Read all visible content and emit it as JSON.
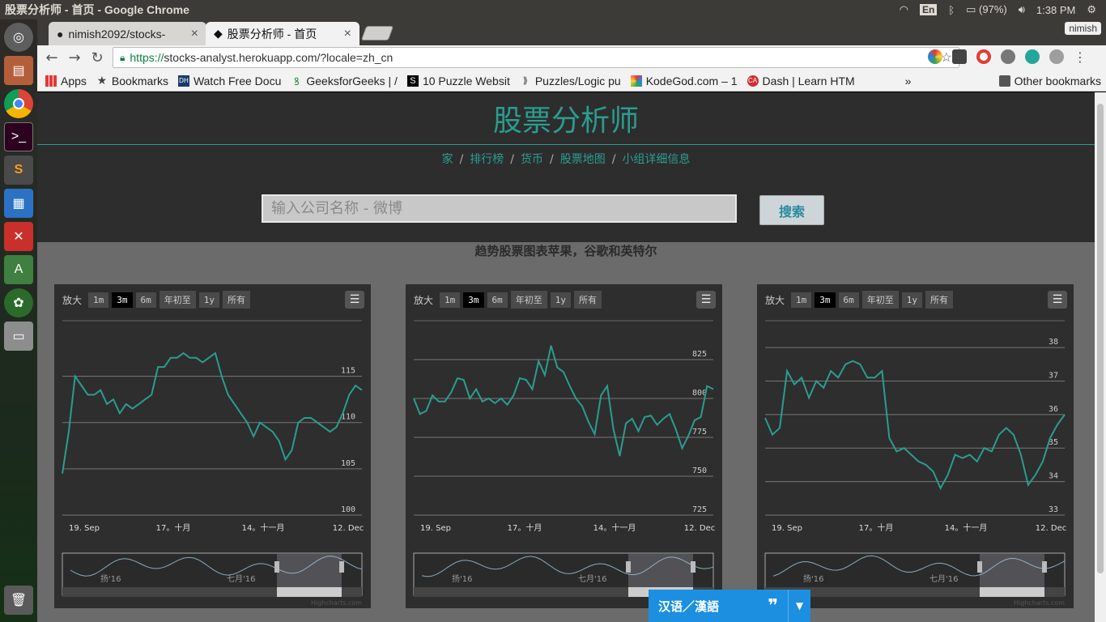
{
  "os": {
    "window_title": "股票分析师 - 首页 - Google Chrome",
    "battery": "(97%)",
    "time": "1:38 PM",
    "ime": "En",
    "launcher_icons": [
      "ubuntu-icon",
      "files-icon",
      "chrome-icon",
      "terminal-icon",
      "sublime-icon",
      "writer-icon",
      "settings-icon",
      "android-studio-icon",
      "android-icon",
      "drive-icon",
      "trash-icon"
    ]
  },
  "browser": {
    "tabs": [
      {
        "title": "nimish2092/stocks-",
        "icon": "github-icon"
      },
      {
        "title": "股票分析师 - 首页",
        "icon": "spartan-icon"
      }
    ],
    "user": "nimish",
    "url_scheme": "https://",
    "url_rest": "stocks-analyst.herokuapp.com/?locale=zh_cn",
    "bookmarks": [
      {
        "label": "Apps",
        "icon": "apps-grid-icon"
      },
      {
        "label": "Bookmarks",
        "icon": "star-icon"
      },
      {
        "label": "Watch Free Docu",
        "icon": "dh-icon"
      },
      {
        "label": "GeeksforGeeks | /",
        "icon": "gfg-icon"
      },
      {
        "label": "10 Puzzle Websit",
        "icon": "s-icon"
      },
      {
        "label": "Puzzles/Logic pu",
        "icon": "puzzle-icon"
      },
      {
        "label": "KodeGod.com – 1",
        "icon": "kodegod-icon"
      },
      {
        "label": "Dash | Learn HTM",
        "icon": "dash-icon"
      }
    ],
    "bookmarks_more": "»",
    "other_bookmarks": "Other bookmarks"
  },
  "site": {
    "title": "股票分析师",
    "nav": [
      "家",
      "排行榜",
      "货币",
      "股票地图",
      "小组详细信息"
    ],
    "search_placeholder": "输入公司名称 - 微博",
    "search_button": "搜索",
    "subtitle": "趋势股票图表苹果，谷歌和英特尔"
  },
  "range_selector": {
    "label": "放大",
    "buttons": [
      "1m",
      "3m",
      "6m",
      "年初至",
      "1y",
      "所有"
    ],
    "selected": "3m"
  },
  "chart_data": [
    {
      "type": "line",
      "x_ticks": [
        "19. Sep",
        "17。十月",
        "14。十一月",
        "12. Dec"
      ],
      "yticks": [
        100,
        105,
        110,
        115
      ],
      "ylim": [
        100,
        121
      ],
      "values": [
        104.5,
        109,
        115,
        114,
        113,
        113,
        113.5,
        112,
        112.5,
        111,
        112,
        111.5,
        112,
        112.5,
        113,
        116,
        116,
        117,
        117,
        117.5,
        117,
        117,
        116.5,
        117,
        117.5,
        115,
        113,
        112,
        111,
        110,
        108.5,
        110,
        109.5,
        109,
        108,
        106,
        107,
        110,
        110.5,
        110.5,
        110,
        109.5,
        109,
        109.5,
        111,
        113,
        114,
        113.5
      ],
      "navigator_labels": [
        "扬'16",
        "七月'16"
      ]
    },
    {
      "type": "line",
      "x_ticks": [
        "19. Sep",
        "17。十月",
        "14。十一月",
        "12. Dec"
      ],
      "yticks": [
        725,
        750,
        775,
        800,
        825
      ],
      "ylim": [
        725,
        850
      ],
      "values": [
        800,
        790,
        792,
        802,
        798,
        798,
        804,
        813,
        812,
        800,
        806,
        798,
        800,
        797,
        800,
        796,
        802,
        813,
        812,
        806,
        824,
        815,
        834,
        820,
        817,
        808,
        800,
        795,
        785,
        777,
        802,
        808,
        780,
        763,
        784,
        787,
        779,
        788,
        789,
        783,
        787,
        790,
        780,
        768,
        776,
        786,
        788,
        808,
        806
      ],
      "navigator_labels": [
        "扬'16",
        "七月'16"
      ]
    },
    {
      "type": "line",
      "x_ticks": [
        "19. Sep",
        "17。十月",
        "14。十一月",
        "12. Dec"
      ],
      "yticks": [
        33,
        34,
        35,
        36,
        37,
        38
      ],
      "ylim": [
        33,
        38.8
      ],
      "values": [
        35.9,
        35.4,
        35.6,
        37.3,
        36.9,
        37.1,
        36.5,
        37.0,
        36.8,
        37.3,
        37.1,
        37.5,
        37.6,
        37.5,
        37.1,
        37.1,
        37.3,
        35.3,
        34.9,
        35.0,
        34.8,
        34.6,
        34.5,
        34.3,
        33.8,
        34.2,
        34.8,
        34.7,
        34.8,
        34.6,
        35.0,
        34.9,
        35.4,
        35.6,
        35.4,
        34.8,
        33.9,
        34.2,
        34.6,
        35.3,
        35.7,
        36.0
      ],
      "navigator_labels": [
        "扬'16",
        "七月'16"
      ]
    }
  ],
  "credits": "Highcharts.com",
  "translator": {
    "label": "汉语／漢語",
    "quote": "❞",
    "arrow": "▼"
  }
}
